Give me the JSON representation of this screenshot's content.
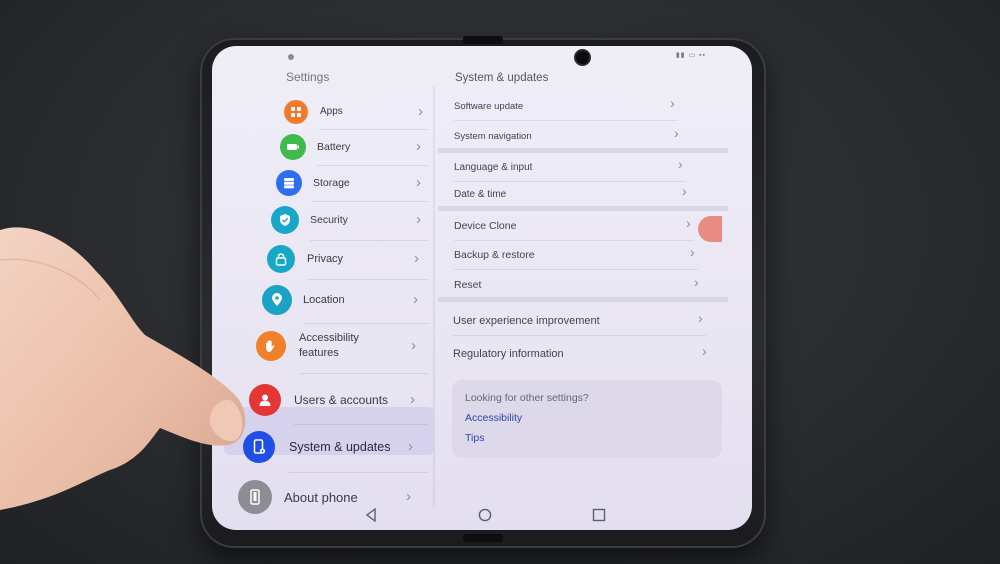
{
  "left_pane": {
    "title": "Settings",
    "items": [
      {
        "label": "Apps",
        "icon": "apps-grid-icon",
        "color": "#f07a2c"
      },
      {
        "label": "Battery",
        "icon": "battery-icon",
        "color": "#3fbb4e"
      },
      {
        "label": "Storage",
        "icon": "storage-icon",
        "color": "#2d6df0"
      },
      {
        "label": "Security",
        "icon": "shield-check-icon",
        "color": "#19a7c9"
      },
      {
        "label": "Privacy",
        "icon": "lock-icon",
        "color": "#17a8c6"
      },
      {
        "label": "Location",
        "icon": "location-pin-icon",
        "color": "#1aa3c4"
      },
      {
        "label": "Accessibility features",
        "icon": "hand-icon",
        "color": "#f0802a"
      },
      {
        "label": "Users & accounts",
        "icon": "user-icon",
        "color": "#e53636"
      },
      {
        "label": "System & updates",
        "icon": "phone-gear-icon",
        "color": "#1f4fe6"
      },
      {
        "label": "About phone",
        "icon": "phone-icon",
        "color": "#8d8d94"
      }
    ],
    "selected": "System & updates"
  },
  "right_pane": {
    "title": "System & updates",
    "groups": [
      [
        "Software update",
        "System navigation"
      ],
      [
        "Language & input",
        "Date & time"
      ],
      [
        "Device Clone",
        "Backup & restore",
        "Reset"
      ],
      [
        "User experience improvement",
        "Regulatory information"
      ]
    ],
    "suggestions": {
      "header": "Looking for other settings?",
      "links": [
        "Accessibility",
        "Tips"
      ]
    }
  },
  "nav_bar": {
    "back_icon": "triangle-back-icon",
    "home_icon": "circle-home-icon",
    "recents_icon": "square-recents-icon"
  },
  "colors": {
    "screen_bg": "#ece9f5",
    "selected_bg": "#d6d1ec",
    "link": "#2f45a8",
    "floating_bubble": "#e98b85"
  }
}
